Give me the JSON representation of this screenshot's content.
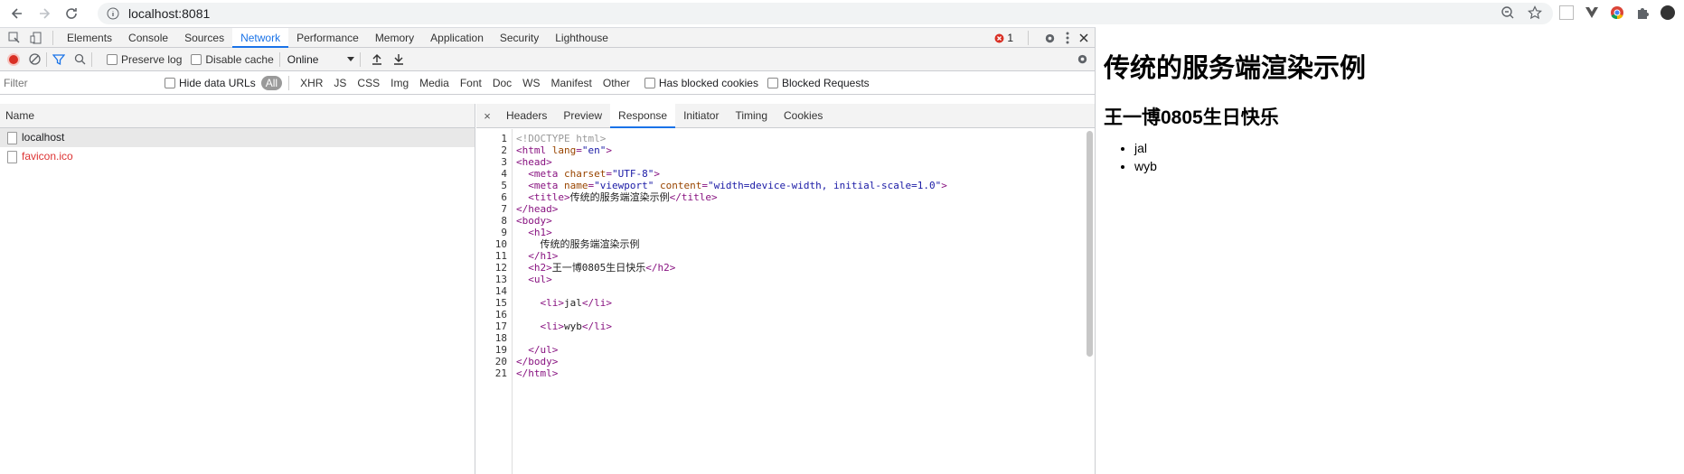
{
  "browser": {
    "url": "localhost:8081",
    "nav": [
      "back-icon",
      "forward-icon",
      "reload-icon"
    ],
    "omnibox_icons": [
      "zoom-icon",
      "star-icon"
    ],
    "extension_icons": [
      "ext-icon-1",
      "vue-icon",
      "chrome-icon",
      "puzzle-icon",
      "avatar"
    ]
  },
  "devtools": {
    "tabs": [
      "Elements",
      "Console",
      "Sources",
      "Network",
      "Performance",
      "Memory",
      "Application",
      "Security",
      "Lighthouse"
    ],
    "active_tab": "Network",
    "error_count": "1",
    "toolbar": {
      "preserve_log": "Preserve log",
      "disable_cache": "Disable cache",
      "throttling": "Online"
    },
    "filter": {
      "placeholder": "Filter",
      "hide_data_urls": "Hide data URLs",
      "types": [
        "All",
        "XHR",
        "JS",
        "CSS",
        "Img",
        "Media",
        "Font",
        "Doc",
        "WS",
        "Manifest",
        "Other"
      ],
      "active_type": "All",
      "has_blocked_cookies": "Has blocked cookies",
      "blocked_requests": "Blocked Requests"
    },
    "requests": {
      "header": "Name",
      "rows": [
        {
          "name": "localhost",
          "status": "ok"
        },
        {
          "name": "favicon.ico",
          "status": "error"
        }
      ]
    },
    "details": {
      "close": "×",
      "tabs": [
        "Headers",
        "Preview",
        "Response",
        "Initiator",
        "Timing",
        "Cookies"
      ],
      "active_tab": "Response",
      "response_lines": [
        "<!DOCTYPE html>",
        "<html lang=\"en\">",
        "<head>",
        "  <meta charset=\"UTF-8\">",
        "  <meta name=\"viewport\" content=\"width=device-width, initial-scale=1.0\">",
        "  <title>传统的服务端渲染示例</title>",
        "</head>",
        "<body>",
        "  <h1>",
        "    传统的服务端渲染示例",
        "  </h1>",
        "  <h2>王一博0805生日快乐</h2>",
        "  <ul>",
        "",
        "    <li>jal</li>",
        "",
        "    <li>wyb</li>",
        "",
        "  </ul>",
        "</body>",
        "</html>"
      ]
    }
  },
  "page": {
    "h1": "传统的服务端渲染示例",
    "h2": "王一博0805生日快乐",
    "items": [
      "jal",
      "wyb"
    ]
  }
}
